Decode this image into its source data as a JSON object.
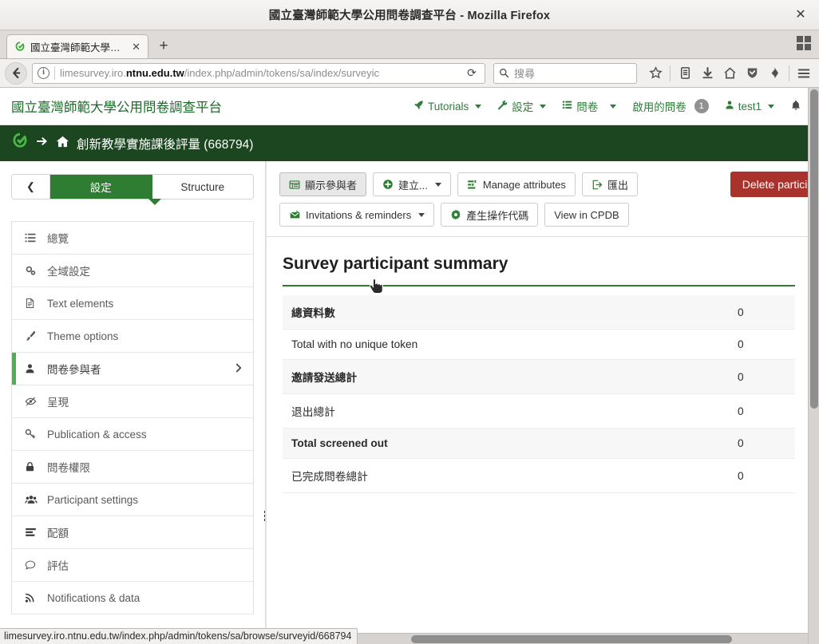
{
  "browser": {
    "window_title": "國立臺灣師範大學公用問卷調查平台 - Mozilla Firefox",
    "close_label": "✕",
    "tab": {
      "label": "國立臺灣師範大學公...",
      "close_label": "✕",
      "favicon": "limesurvey-favicon-icon"
    },
    "new_tab_label": "+",
    "url": "limesurvey.iro.",
    "url_host_bold": "ntnu.edu.tw",
    "url_rest": "/index.php/admin/tokens/sa/index/surveyic",
    "reload_label": "⟳",
    "search_placeholder": "搜尋",
    "status_url": "limesurvey.iro.ntnu.edu.tw/index.php/admin/tokens/sa/browse/surveyid/668794"
  },
  "app": {
    "brand": "國立臺灣師範大學公用問卷調查平台",
    "nav_items": [
      {
        "label": "Tutorials",
        "icon": "rocket-icon",
        "caret": true,
        "badge": null
      },
      {
        "label": "設定",
        "icon": "wrench-icon",
        "caret": true,
        "badge": null
      },
      {
        "label": "問卷",
        "icon": "list-icon",
        "caret": true,
        "badge": null
      },
      {
        "label": "啟用的問卷",
        "icon": null,
        "caret": false,
        "badge": "1"
      },
      {
        "label": "test1",
        "icon": "user-icon",
        "caret": true,
        "badge": null
      },
      {
        "label": "",
        "icon": "bell-icon",
        "caret": false,
        "badge": null
      }
    ]
  },
  "breadcrumb": {
    "logo": "limesurvey-logo-icon",
    "arrow": "arrow-right-icon",
    "home": "home-icon",
    "title": "創新教學實施課後評量 (668794)"
  },
  "sidebar": {
    "collapse_label": "❮",
    "tabs": [
      {
        "label": "設定",
        "active": true
      },
      {
        "label": "Structure",
        "active": false
      }
    ],
    "items": [
      {
        "label": "總覽",
        "icon": "list-ul-icon",
        "active": false,
        "chevron": false
      },
      {
        "label": "全域設定",
        "icon": "cogs-icon",
        "active": false,
        "chevron": false
      },
      {
        "label": "Text elements",
        "icon": "file-text-icon",
        "active": false,
        "chevron": false
      },
      {
        "label": "Theme options",
        "icon": "paint-brush-icon",
        "active": false,
        "chevron": false
      },
      {
        "label": "問卷參與者",
        "icon": "user-icon",
        "active": true,
        "chevron": true
      },
      {
        "label": "呈現",
        "icon": "eye-slash-icon",
        "active": false,
        "chevron": false
      },
      {
        "label": "Publication & access",
        "icon": "key-icon",
        "active": false,
        "chevron": false
      },
      {
        "label": "問卷權限",
        "icon": "lock-icon",
        "active": false,
        "chevron": false
      },
      {
        "label": "Participant settings",
        "icon": "users-icon",
        "active": false,
        "chevron": false
      },
      {
        "label": "配額",
        "icon": "tasks-icon",
        "active": false,
        "chevron": false
      },
      {
        "label": "評估",
        "icon": "comment-icon",
        "active": false,
        "chevron": false
      },
      {
        "label": "Notifications & data",
        "icon": "rss-icon",
        "active": false,
        "chevron": false
      }
    ]
  },
  "toolbar": {
    "row1": [
      {
        "label": "顯示參與者",
        "icon": "table-icon",
        "caret": false,
        "pressed": true
      },
      {
        "label": "建立...",
        "icon": "plus-circle-icon",
        "caret": true,
        "pressed": false
      },
      {
        "label": "Manage attributes",
        "icon": "sliders-icon",
        "caret": false,
        "pressed": false
      },
      {
        "label": "匯出",
        "icon": "export-icon",
        "caret": false,
        "pressed": false
      }
    ],
    "row2": [
      {
        "label": "Invitations & reminders",
        "icon": "envelope-icon",
        "caret": true,
        "pressed": false
      },
      {
        "label": "產生操作代碼",
        "icon": "gear-icon",
        "caret": false,
        "pressed": false
      },
      {
        "label": "View in CPDB",
        "icon": null,
        "caret": false,
        "pressed": false
      }
    ],
    "delete_label": "Delete participa",
    "delete_color": "#a9322d"
  },
  "main": {
    "heading": "Survey participant summary",
    "rows": [
      {
        "label": "總資料數",
        "value": "0"
      },
      {
        "label": "Total with no unique token",
        "value": "0"
      },
      {
        "label": "邀請發送總計",
        "value": "0"
      },
      {
        "label": "退出總計",
        "value": "0"
      },
      {
        "label": "Total screened out",
        "value": "0"
      },
      {
        "label": "已完成問卷總計",
        "value": "0"
      }
    ]
  },
  "theme": {
    "accent_green": "#2e7d32",
    "dark_green": "#1b4620",
    "brand_green": "#1b6b28",
    "danger_red": "#a9322d"
  }
}
